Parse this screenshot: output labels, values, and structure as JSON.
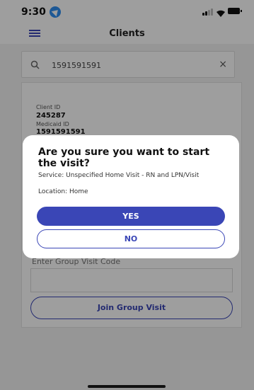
{
  "status_bar": {
    "time": "9:30",
    "location_icon": "location-arrow-icon",
    "signal_icon": "signal-icon",
    "wifi_icon": "wifi-icon",
    "battery_icon": "battery-icon"
  },
  "nav": {
    "title": "Clients",
    "menu_icon": "hamburger-menu-icon"
  },
  "search": {
    "value": "1591591591",
    "search_icon": "search-icon",
    "clear_icon": "close-icon",
    "clear_glyph": "×"
  },
  "client": {
    "client_id_label": "Client ID",
    "client_id": "245287",
    "medicaid_id_label": "Medicaid ID",
    "medicaid_id": "1591591591"
  },
  "group_visit": {
    "label": "Enter Group Visit Code",
    "join_label": "Join Group Visit"
  },
  "dialog": {
    "title": "Are you sure you want to start the visit?",
    "service": "Service: Unspecified Home Visit - RN and LPN/Visit",
    "location": "Location: Home",
    "yes_label": "YES",
    "no_label": "NO"
  },
  "colors": {
    "accent": "#3a46b6",
    "location_badge": "#2f8ef0"
  }
}
